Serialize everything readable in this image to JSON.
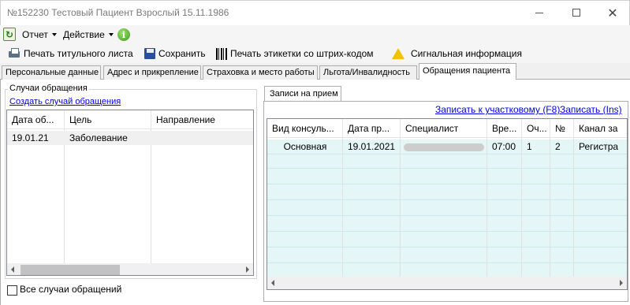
{
  "window": {
    "title": "№152230 Тестовый Пациент Взрослый 15.11.1986"
  },
  "menu": {
    "refresh_icon": "refresh-icon",
    "report": "Отчет",
    "action": "Действие",
    "info_icon": "info-icon"
  },
  "toolbar": {
    "print_title": "Печать титульного листа",
    "save": "Сохранить",
    "print_barcode": "Печать этикетки со штрих-кодом",
    "signal_info": "Сигнальная информация"
  },
  "tabs": [
    {
      "label": "Персональные данные"
    },
    {
      "label": "Адрес и прикрепление"
    },
    {
      "label": "Страховка и место работы"
    },
    {
      "label": "Льгота/Инвалидность"
    },
    {
      "label": "Обращения пациента"
    }
  ],
  "cases": {
    "group_title": "Случаи обращения",
    "create_link": "Создать случай обращения",
    "columns": [
      "Дата об...",
      "Цель",
      "Направление"
    ],
    "rows": [
      {
        "date": "19.01.21",
        "goal": "Заболевание",
        "direction": ""
      }
    ],
    "all_cases_label": "Все случаи обращений",
    "all_cases_checked": false
  },
  "appointments": {
    "tab_label": "Записи на прием",
    "link_to_district": "Записать к участковому (F8)",
    "link_record": "Записать (Ins)",
    "columns": [
      "Вид консуль...",
      "Дата пр...",
      "Специалист",
      "Вре...",
      "Оч...",
      "№",
      "Канал за"
    ],
    "rows": [
      {
        "type": "Основная",
        "date": "19.01.2021",
        "specialist": "",
        "time": "07:00",
        "queue": "1",
        "number": "2",
        "channel": "Регистра"
      }
    ]
  },
  "colors": {
    "link": "#0000ee",
    "selected_row": "#f0f0f0",
    "alt_row": "#e4f6f6"
  }
}
